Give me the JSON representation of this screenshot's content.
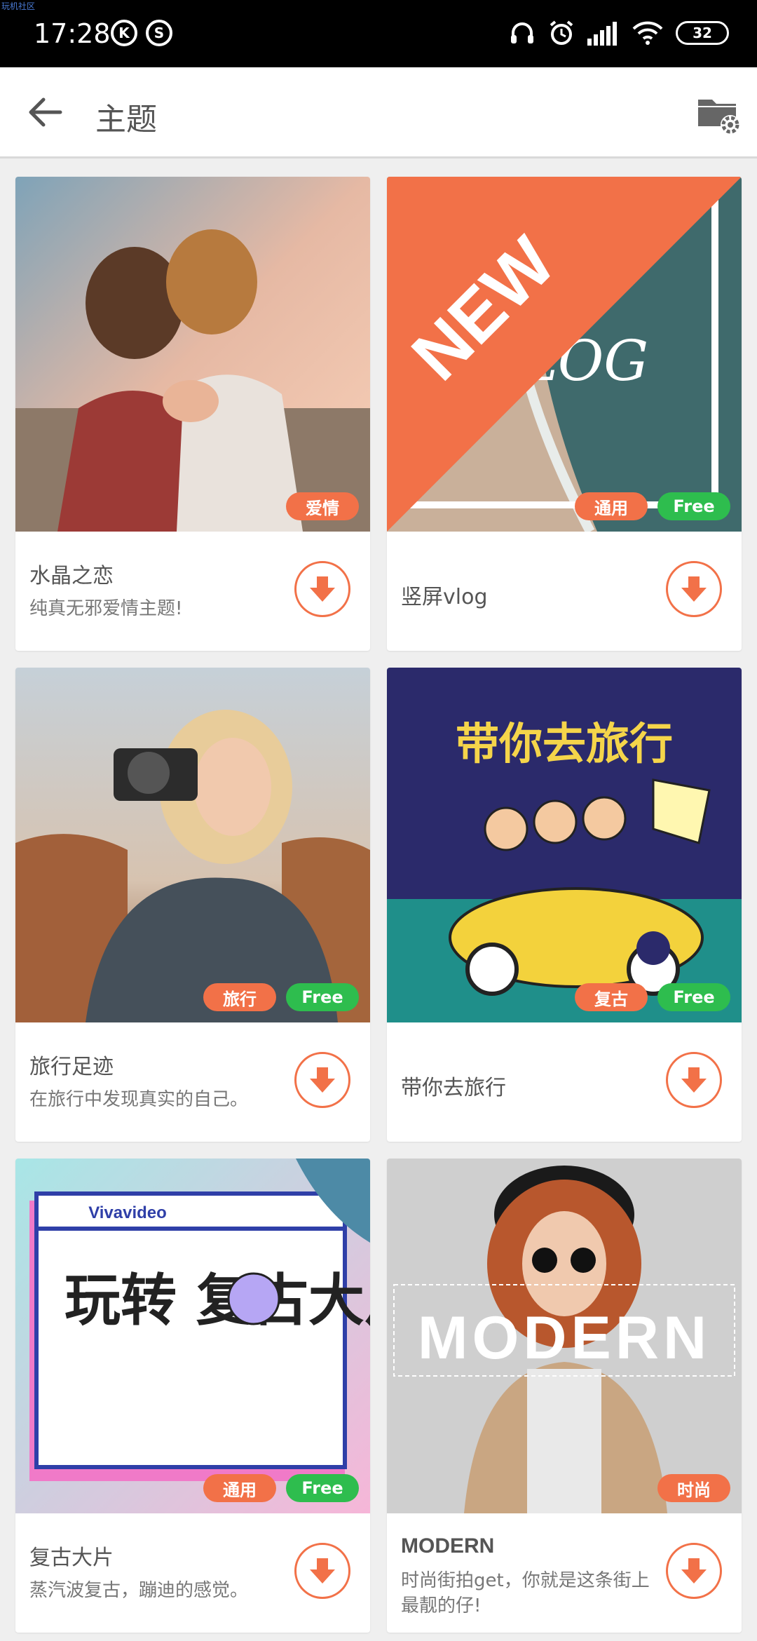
{
  "statusbar": {
    "time": "17:28",
    "battery": "32",
    "watermark": "玩机社区"
  },
  "appbar": {
    "title": "主题"
  },
  "colors": {
    "accent": "#f27148",
    "free": "#2ebd4e"
  },
  "themes": [
    {
      "name": "水晶之恋",
      "desc": "纯真无邪爱情主题!",
      "badges": [
        "爱情"
      ],
      "free": false,
      "new": false
    },
    {
      "name": "竖屏vlog",
      "desc": "",
      "badges": [
        "通用"
      ],
      "free": true,
      "new": true,
      "thumb_text": "VLOG",
      "new_label": "NEW"
    },
    {
      "name": "旅行足迹",
      "desc": "在旅行中发现真实的自己。",
      "badges": [
        "旅行"
      ],
      "free": true,
      "new": false
    },
    {
      "name": "带你去旅行",
      "desc": "",
      "badges": [
        "复古"
      ],
      "free": true,
      "new": false,
      "thumb_text": "带你去旅行"
    },
    {
      "name": "复古大片",
      "desc": "蒸汽波复古，蹦迪的感觉。",
      "badges": [
        "通用"
      ],
      "free": true,
      "new": false,
      "thumb_text": "玩转 复古大片",
      "thumb_brand": "Vivavideo"
    },
    {
      "name": "MODERN",
      "desc": "时尚街拍get，你就是这条街上最靓的仔!",
      "badges": [
        "时尚"
      ],
      "free": false,
      "new": false,
      "thumb_text": "MODERN"
    }
  ],
  "free_label": "Free"
}
